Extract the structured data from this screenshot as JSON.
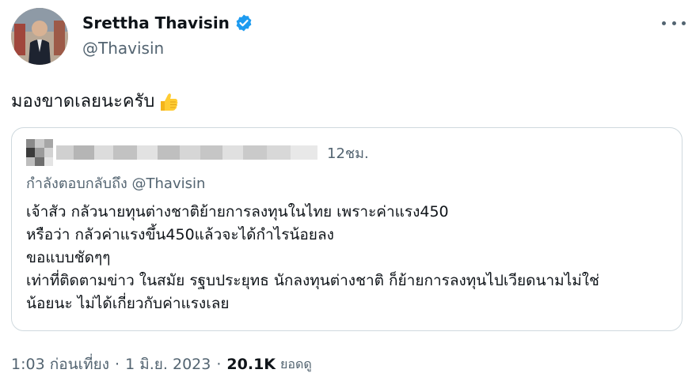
{
  "author": {
    "name": "Srettha Thavisin",
    "handle": "@Thavisin",
    "verified": true,
    "avatar_icon": "profile-photo"
  },
  "tweet": {
    "text": "มองขาดเลยนะครับ",
    "emoji_icon": "thumbs-up-icon"
  },
  "quote": {
    "author_name": "",
    "time": "12ชม.",
    "reply_prefix": "กำลังตอบกลับถึง",
    "reply_mention": "@Thavisin",
    "lines": [
      "เจ้าสัว กลัวนายทุนต่างชาติย้ายการลงทุนในไทย เพราะค่าแรง450",
      "หรือว่า กลัวค่าแรงขึ้น450แล้วจะได้กำไรน้อยลง",
      "ขอแบบชัดๆๆ",
      "เท่าที่ติดตามข่าว ในสมัย รฐบประยุทธ นักลงทุนต่างชาติ ก็ย้ายการลงทุนไปเวียดนามไม่ใช่",
      "น้อยนะ ไม่ได้เกี่ยวกับค่าแรงเลย"
    ]
  },
  "meta": {
    "time": "1:03 ก่อนเที่ยง",
    "separator": "·",
    "date": "1 มิ.ย. 2023",
    "views_count": "20.1K",
    "views_label": "ยอดดู"
  },
  "colors": {
    "text_primary": "#0f1419",
    "text_secondary": "#536471",
    "border": "#cfd9de",
    "verified_blue": "#1d9bf0"
  }
}
